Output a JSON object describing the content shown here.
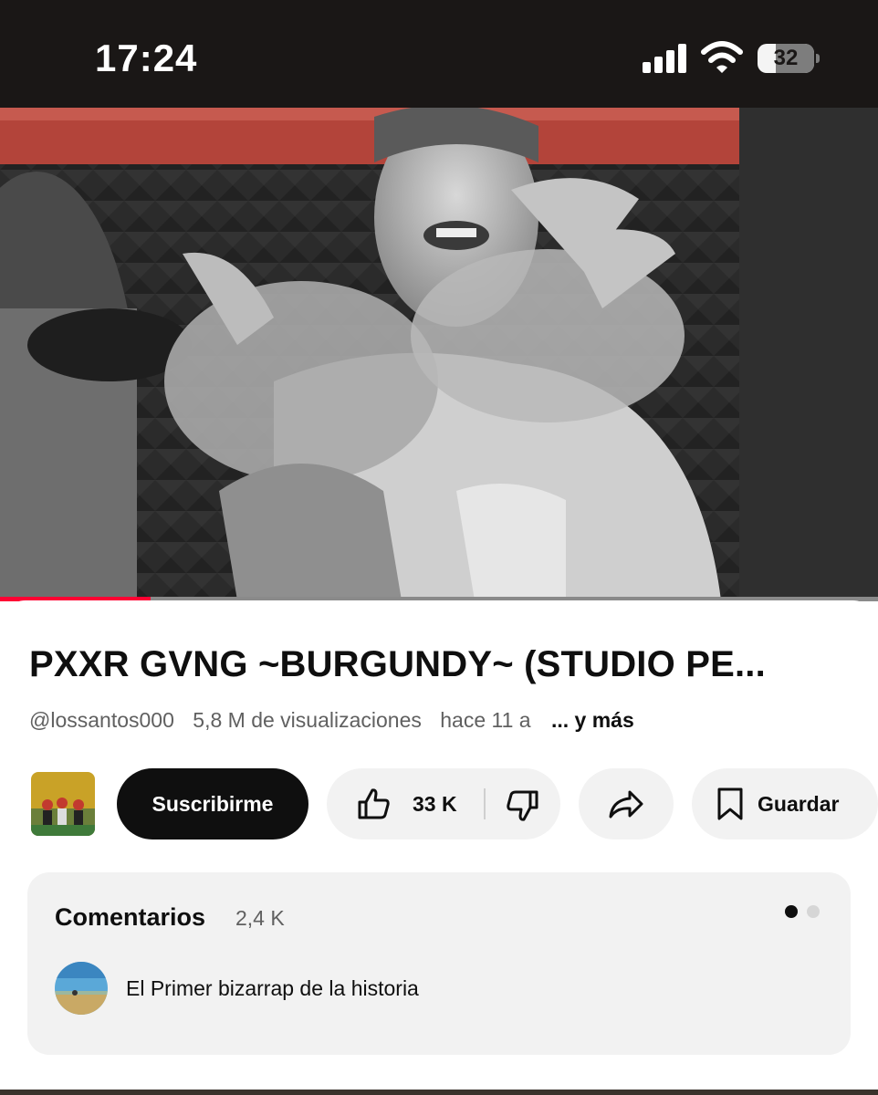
{
  "status_bar": {
    "time": "17:24",
    "battery_level": "32",
    "icons": [
      "cellular-signal-icon",
      "wifi-icon",
      "battery-icon"
    ]
  },
  "video": {
    "progress_fraction": 0.172,
    "progress_color": "#ff0033"
  },
  "details": {
    "title": "PXXR GVNG ~BURGUNDY~ (STUDIO PE...",
    "channel_handle": "@lossantos000",
    "views": "5,8 M de visualizaciones",
    "age": "hace 11 a",
    "more_label": "... y más"
  },
  "actions": {
    "subscribe_label": "Suscribirme",
    "like_count": "33 K",
    "save_label": "Guardar",
    "icons": [
      "thumbs-up-icon",
      "thumbs-down-icon",
      "share-icon",
      "bookmark-icon"
    ]
  },
  "comments": {
    "title": "Comentarios",
    "count": "2,4 K",
    "top_comment": "El Primer bizarrap de la historia",
    "page_indicator": {
      "total": 2,
      "active": 1
    }
  },
  "colors": {
    "accent": "#ff0033",
    "primary_text": "#0f0f0f",
    "secondary_text": "#606060",
    "pill_background": "#f2f2f2",
    "status_bar_background": "#1a1716"
  }
}
